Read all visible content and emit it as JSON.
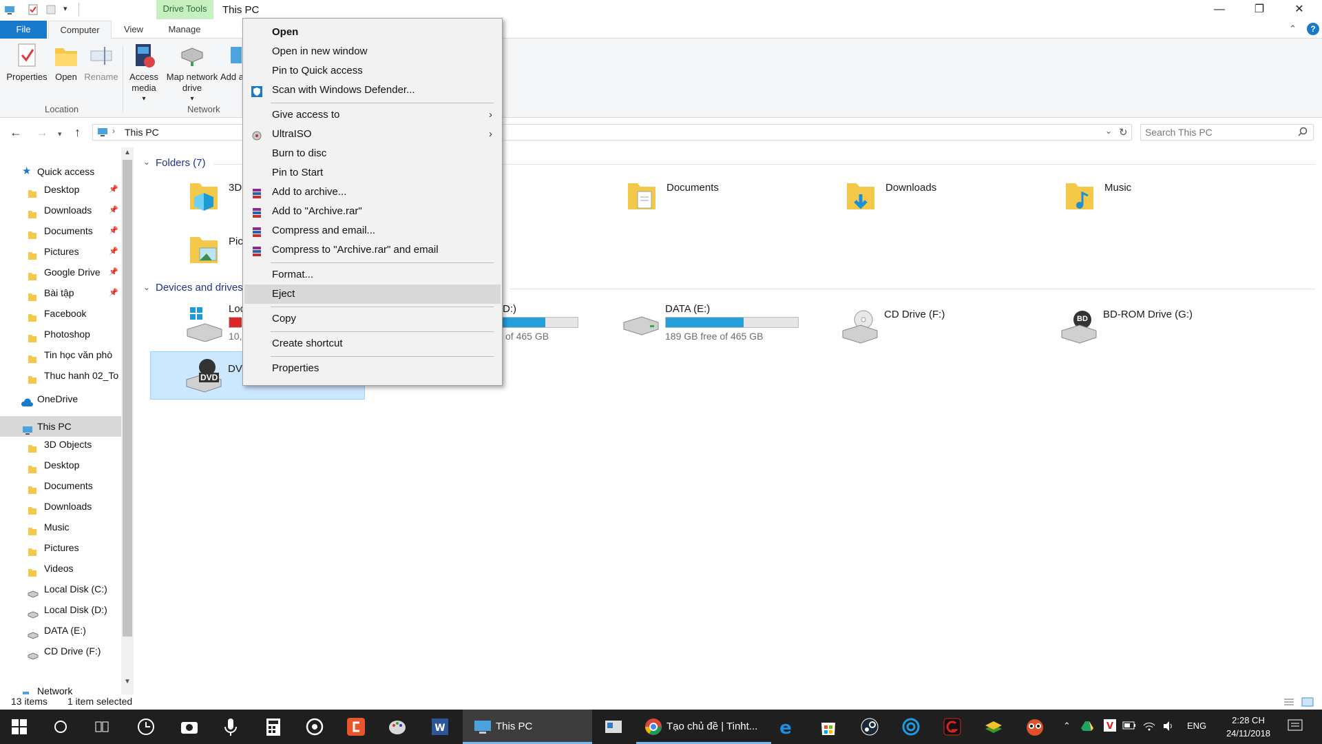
{
  "titlebar": {
    "contextual_tab": "Drive Tools",
    "title": "This PC",
    "minimize": "—",
    "maximize": "❐",
    "close": "✕"
  },
  "ribbon": {
    "tabs": [
      "File",
      "Computer",
      "View",
      "Manage"
    ],
    "buttons": {
      "properties": "Properties",
      "open": "Open",
      "rename": "Rename",
      "access_media": "Access media",
      "map_network_drive": "Map network drive",
      "add_location": "Add a lo"
    },
    "groups": {
      "location": "Location",
      "network": "Network"
    }
  },
  "address": {
    "path": "This PC",
    "search_placeholder": "Search This PC"
  },
  "nav": {
    "quick_access": "Quick access",
    "quick_items": [
      "Desktop",
      "Downloads",
      "Documents",
      "Pictures",
      "Google Drive",
      "Bài tập",
      "Facebook",
      "Photoshop",
      "Tin học văn phò",
      "Thuc hanh 02_To"
    ],
    "onedrive": "OneDrive",
    "this_pc": "This PC",
    "pc_items": [
      "3D Objects",
      "Desktop",
      "Documents",
      "Downloads",
      "Music",
      "Pictures",
      "Videos",
      "Local Disk (C:)",
      "Local Disk (D:)",
      "DATA (E:)",
      "CD Drive (F:)"
    ],
    "network": "Network"
  },
  "content": {
    "folders_header": "Folders (7)",
    "devices_header": "Devices and drives",
    "folders": [
      "3D",
      "Documents",
      "Downloads",
      "Music",
      "Pic"
    ],
    "drives": {
      "c_name": "Loc",
      "c_free": "10,",
      "c_fill": 0.98,
      "d_name": "D:)",
      "d_free": "of 465 GB",
      "d_fill": 0.6,
      "e_name": "DATA (E:)",
      "e_free": "189 GB free of 465 GB",
      "e_fill": 0.59,
      "f_name": "CD Drive (F:)",
      "g_name": "BD-ROM Drive (G:)",
      "dvd_name": "DV",
      "dvd_badge": "DVD",
      "bd_badge": "BD"
    }
  },
  "context_menu": {
    "open": "Open",
    "open_new_window": "Open in new window",
    "pin_quick": "Pin to Quick access",
    "scan": "Scan with Windows Defender...",
    "give_access": "Give access to",
    "ultraiso": "UltraISO",
    "burn": "Burn to disc",
    "pin_start": "Pin to Start",
    "add_archive": "Add to archive...",
    "add_archive_rar": "Add to \"Archive.rar\"",
    "compress_email": "Compress and email...",
    "compress_rar_email": "Compress to \"Archive.rar\" and email",
    "format": "Format...",
    "eject": "Eject",
    "copy": "Copy",
    "create_shortcut": "Create shortcut",
    "properties": "Properties",
    "arrow": "›"
  },
  "status": {
    "items": "13 items",
    "selected": "1 item selected"
  },
  "taskbar": {
    "explorer_label": "This PC",
    "chrome_label": "Tạo chủ đề | Tinht...",
    "lang": "ENG",
    "time": "2:28 CH",
    "date": "24/11/2018"
  },
  "colors": {
    "accent": "#1979ca",
    "drive_fill": "#26a0da",
    "drive_full": "#da2626",
    "selection": "#cce8ff",
    "taskbar": "#1f1f1f"
  }
}
